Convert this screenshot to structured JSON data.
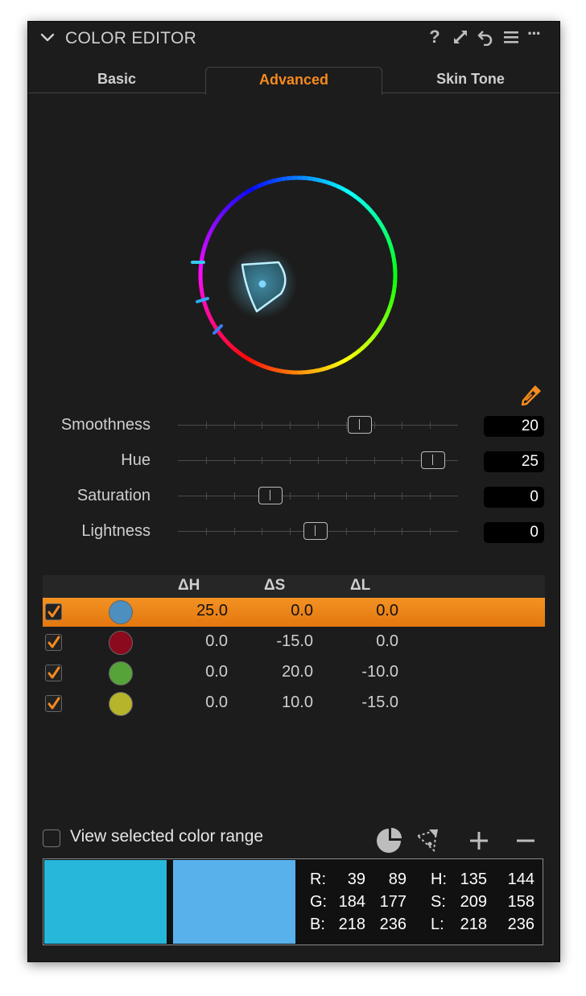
{
  "panel": {
    "title": "COLOR EDITOR",
    "header_icons": [
      "help-icon",
      "expand-icon",
      "reset-icon",
      "menu-icon",
      "more-icon"
    ],
    "help_glyph": "?",
    "more_glyph": "···"
  },
  "tabs": [
    {
      "label": "Basic",
      "active": false
    },
    {
      "label": "Advanced",
      "active": true
    },
    {
      "label": "Skin Tone",
      "active": false
    }
  ],
  "accent_color": "#f58a1f",
  "sliders": [
    {
      "label": "Smoothness",
      "value": "20",
      "position": 0.65
    },
    {
      "label": "Hue",
      "value": "25",
      "position": 0.91
    },
    {
      "label": "Saturation",
      "value": "0",
      "position": 0.33
    },
    {
      "label": "Lightness",
      "value": "0",
      "position": 0.49
    }
  ],
  "table": {
    "headers": [
      "ΔH",
      "ΔS",
      "ΔL"
    ],
    "rows": [
      {
        "checked": true,
        "selected": true,
        "color": "#4d8fbf",
        "dh": "25.0",
        "ds": "0.0",
        "dl": "0.0"
      },
      {
        "checked": true,
        "selected": false,
        "color": "#8b0a1e",
        "dh": "0.0",
        "ds": "-15.0",
        "dl": "0.0"
      },
      {
        "checked": true,
        "selected": false,
        "color": "#56a33a",
        "dh": "0.0",
        "ds": "20.0",
        "dl": "-10.0"
      },
      {
        "checked": true,
        "selected": false,
        "color": "#b5b42a",
        "dh": "0.0",
        "ds": "10.0",
        "dl": "-15.0"
      }
    ]
  },
  "view_range": {
    "label": "View selected color range",
    "checked": false
  },
  "tool_icons": [
    "pie-picker-icon",
    "range-picker-icon",
    "add-icon",
    "remove-icon"
  ],
  "readout": {
    "before_color": "#27b7db",
    "after_color": "#59b1ec",
    "rgb": [
      {
        "label": "R:",
        "a": "39",
        "b": "89"
      },
      {
        "label": "G:",
        "a": "184",
        "b": "177"
      },
      {
        "label": "B:",
        "a": "218",
        "b": "236"
      }
    ],
    "hsl": [
      {
        "label": "H:",
        "a": "135",
        "b": "144"
      },
      {
        "label": "S:",
        "a": "209",
        "b": "158"
      },
      {
        "label": "L:",
        "a": "218",
        "b": "236"
      }
    ]
  }
}
